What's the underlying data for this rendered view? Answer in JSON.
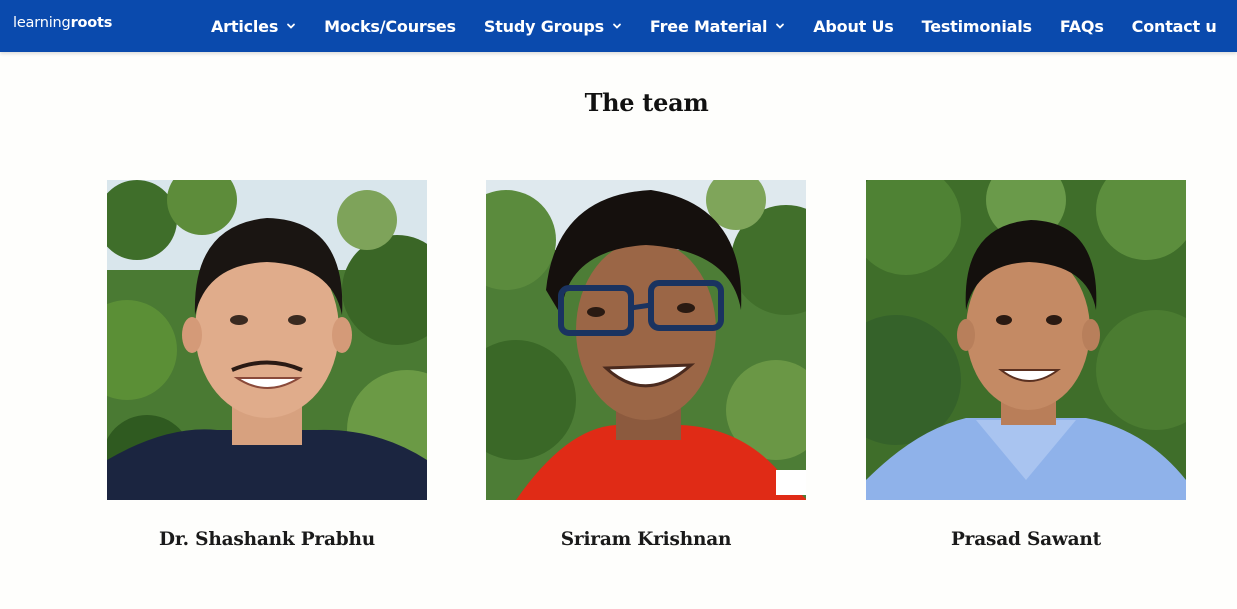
{
  "header": {
    "logo_light": "learning",
    "logo_bold": "roots",
    "nav": [
      {
        "label": "Articles",
        "has_dropdown": true
      },
      {
        "label": "Mocks/Courses",
        "has_dropdown": false
      },
      {
        "label": "Study Groups",
        "has_dropdown": true
      },
      {
        "label": "Free Material",
        "has_dropdown": true
      },
      {
        "label": "About Us",
        "has_dropdown": false
      },
      {
        "label": "Testimonials",
        "has_dropdown": false
      },
      {
        "label": "FAQs",
        "has_dropdown": false
      },
      {
        "label": "Contact u",
        "has_dropdown": false
      }
    ]
  },
  "main": {
    "title": "The team",
    "team": [
      {
        "name": "Dr. Shashank Prabhu",
        "shirt_color": "#1b2540"
      },
      {
        "name": "Sriram Krishnan",
        "shirt_color": "#e02b16"
      },
      {
        "name": "Prasad Sawant",
        "shirt_color": "#8fb2ea"
      }
    ]
  },
  "colors": {
    "nav_background": "#0a4aad",
    "page_background": "#fefefc",
    "foliage": "#3f6e2a"
  }
}
